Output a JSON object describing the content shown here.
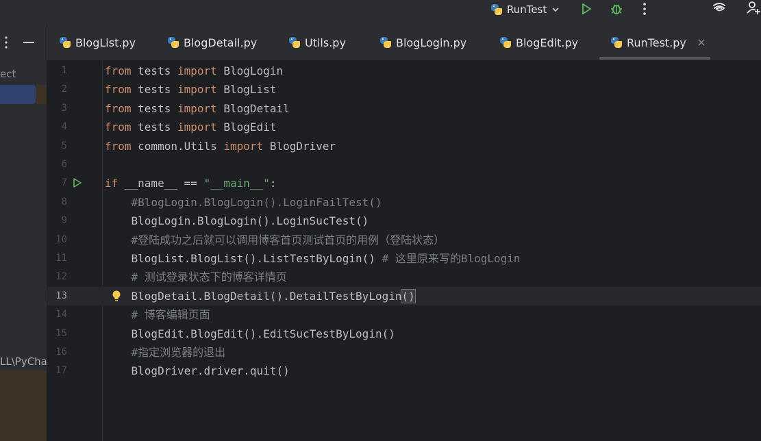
{
  "toolbar": {
    "run_config_label": "RunTest",
    "icons": [
      "python-icon",
      "chevron-down-icon",
      "run-icon",
      "debug-icon",
      "more-icon",
      "ai-assistant-icon",
      "add-user-icon"
    ]
  },
  "left_panel": {
    "truncated_title": "ect",
    "truncated_path": "LL\\PyChar"
  },
  "tabs": [
    {
      "label": "BlogList.py",
      "active": false
    },
    {
      "label": "BlogDetail.py",
      "active": false
    },
    {
      "label": "Utils.py",
      "active": false
    },
    {
      "label": "BlogLogin.py",
      "active": false
    },
    {
      "label": "BlogEdit.py",
      "active": false
    },
    {
      "label": "RunTest.py",
      "active": true
    }
  ],
  "editor": {
    "current_line": 13,
    "lines": [
      {
        "n": "1",
        "segments": [
          {
            "t": "from",
            "c": "kw"
          },
          {
            "t": " tests ",
            "c": ""
          },
          {
            "t": "import",
            "c": "kw"
          },
          {
            "t": " BlogLogin",
            "c": ""
          }
        ]
      },
      {
        "n": "2",
        "segments": [
          {
            "t": "from",
            "c": "kw"
          },
          {
            "t": " tests ",
            "c": ""
          },
          {
            "t": "import",
            "c": "kw"
          },
          {
            "t": " BlogList",
            "c": ""
          }
        ]
      },
      {
        "n": "3",
        "segments": [
          {
            "t": "from",
            "c": "kw"
          },
          {
            "t": " tests ",
            "c": ""
          },
          {
            "t": "import",
            "c": "kw"
          },
          {
            "t": " BlogDetail",
            "c": ""
          }
        ]
      },
      {
        "n": "4",
        "segments": [
          {
            "t": "from",
            "c": "kw"
          },
          {
            "t": " tests ",
            "c": ""
          },
          {
            "t": "import",
            "c": "kw"
          },
          {
            "t": " BlogEdit",
            "c": ""
          }
        ]
      },
      {
        "n": "5",
        "segments": [
          {
            "t": "from",
            "c": "kw"
          },
          {
            "t": " common.Utils ",
            "c": ""
          },
          {
            "t": "import",
            "c": "kw"
          },
          {
            "t": " BlogDriver",
            "c": ""
          }
        ]
      },
      {
        "n": "6",
        "segments": []
      },
      {
        "n": "7",
        "segments": [
          {
            "t": "if",
            "c": "kw"
          },
          {
            "t": " __name__ == ",
            "c": ""
          },
          {
            "t": "\"__main__\"",
            "c": "str"
          },
          {
            "t": ":",
            "c": ""
          }
        ]
      },
      {
        "n": "8",
        "segments": [
          {
            "t": "    #BlogLogin.BlogLogin().LoginFailTest()",
            "c": "cm"
          }
        ]
      },
      {
        "n": "9",
        "segments": [
          {
            "t": "    BlogLogin.BlogLogin().LoginSucTest()",
            "c": ""
          }
        ]
      },
      {
        "n": "10",
        "segments": [
          {
            "t": "    #登陆成功之后就可以调用博客首页测试首页的用例（登陆状态）",
            "c": "cm"
          }
        ]
      },
      {
        "n": "11",
        "segments": [
          {
            "t": "    BlogList.BlogList().ListTestByLogin() ",
            "c": ""
          },
          {
            "t": "# 这里原来写的BlogLogin",
            "c": "cm"
          }
        ]
      },
      {
        "n": "12",
        "segments": [
          {
            "t": "    # 测试登录状态下的博客详情页",
            "c": "cm"
          }
        ]
      },
      {
        "n": "13",
        "segments": [
          {
            "t": "    BlogDetail.BlogDetail().DetailTestByLogin",
            "c": ""
          },
          {
            "t": "()",
            "c": "bracket"
          }
        ]
      },
      {
        "n": "14",
        "segments": [
          {
            "t": "    # 博客编辑页面",
            "c": "cm"
          }
        ]
      },
      {
        "n": "15",
        "segments": [
          {
            "t": "    BlogEdit.BlogEdit().EditSucTestByLogin()",
            "c": ""
          }
        ]
      },
      {
        "n": "16",
        "segments": [
          {
            "t": "    #指定浏览器的退出",
            "c": "cm"
          }
        ]
      },
      {
        "n": "17",
        "segments": [
          {
            "t": "    BlogDriver.driver.quit()",
            "c": ""
          }
        ]
      }
    ]
  },
  "colors": {
    "background": "#1e1f22",
    "panel": "#2b2d30",
    "keyword": "#cf8e6d",
    "string": "#6aab73",
    "comment": "#7a7e85",
    "run_green": "#5fb865"
  }
}
